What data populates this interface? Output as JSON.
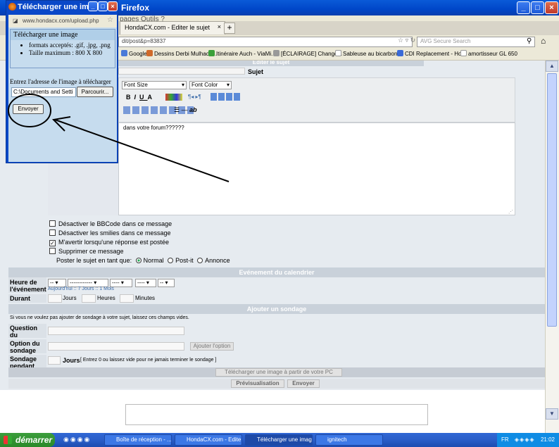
{
  "firefox": {
    "title": "Firefox",
    "menu": "pages   Outils   ?",
    "tabs": [
      {
        "label": "HondaCX.com - Editer le sujet"
      }
    ],
    "url": "dit/post&p=83837",
    "search_placeholder": "AVG Secure Search",
    "bookmarks": [
      "Google",
      "Dessins Derbi Mulhacé...",
      "Itinéraire Auch - ViaMi...",
      "[ÉCLAIRAGE] Change...",
      "Sableuse au bicarbon...",
      "CDI Replacement - Ho...",
      "amortisseur GL 650"
    ]
  },
  "form": {
    "edit_header": "Editer le sujet",
    "subject_label": "Sujet",
    "font_size": "Font Size",
    "font_color": "Font Color",
    "message_text": "dans votre forum??????",
    "options": [
      {
        "label": "Désactiver le BBCode dans ce message",
        "checked": false
      },
      {
        "label": "Désactiver les smilies dans ce message",
        "checked": false
      },
      {
        "label": "M'avertir lorsqu'une réponse est postée",
        "checked": true
      },
      {
        "label": "Supprimer ce message",
        "checked": false
      }
    ],
    "post_type_label": "Poster le sujet en tant que:",
    "post_types": [
      "Normal",
      "Post-it",
      "Annonce"
    ]
  },
  "calendar": {
    "header": "Evénement du calendrier",
    "heure_label": "Heure de l'événement",
    "day_sel": "--",
    "month_sel": "------------",
    "year_sel": "----",
    "hour_sel": "----",
    "min_sel": "--",
    "quick_links": "Aujourd'hui :: 7 Jours :: 1 Mois",
    "duree_label": "Durant",
    "jours": "Jours",
    "heures": "Heures",
    "minutes": "Minutes"
  },
  "poll": {
    "header": "Ajouter un sondage",
    "info": "Si vous ne voulez pas ajouter de sondage à votre sujet, laissez ces champs vides.",
    "question_label": "Question du sondage",
    "option_label": "Option du sondage",
    "add_option": "Ajouter l'option",
    "duration_label": "Sondage pendant",
    "jours": "Jours",
    "duration_hint": "[ Entrez 0 ou laissez vide pour ne jamais terminer le sondage ]"
  },
  "upload_bar": "Télécharger une image à partir de votre PC",
  "buttons": {
    "preview": "Prévisualisation",
    "send": "Envoyer"
  },
  "popup": {
    "title": "Télécharger une image...",
    "url": "www.hondacx.com/upload.php",
    "heading": "Télécharger une image",
    "formats": "formats acceptés: .gif, .jpg, .png",
    "size": "Taille maximum : 800 X 800",
    "enter_label": "Entrez l'adresse de l'image à télécharger",
    "path_value": "C:\\Documents and Setti",
    "browse": "Parcourir...",
    "submit": "Envoyer"
  },
  "taskbar": {
    "start": "démarrer",
    "tasks": [
      "Boîte de réception - ...",
      "HondaCX.com - Edite...",
      "Télécharger une imag...",
      "ignitech"
    ],
    "lang": "FR",
    "time": "21:02"
  }
}
